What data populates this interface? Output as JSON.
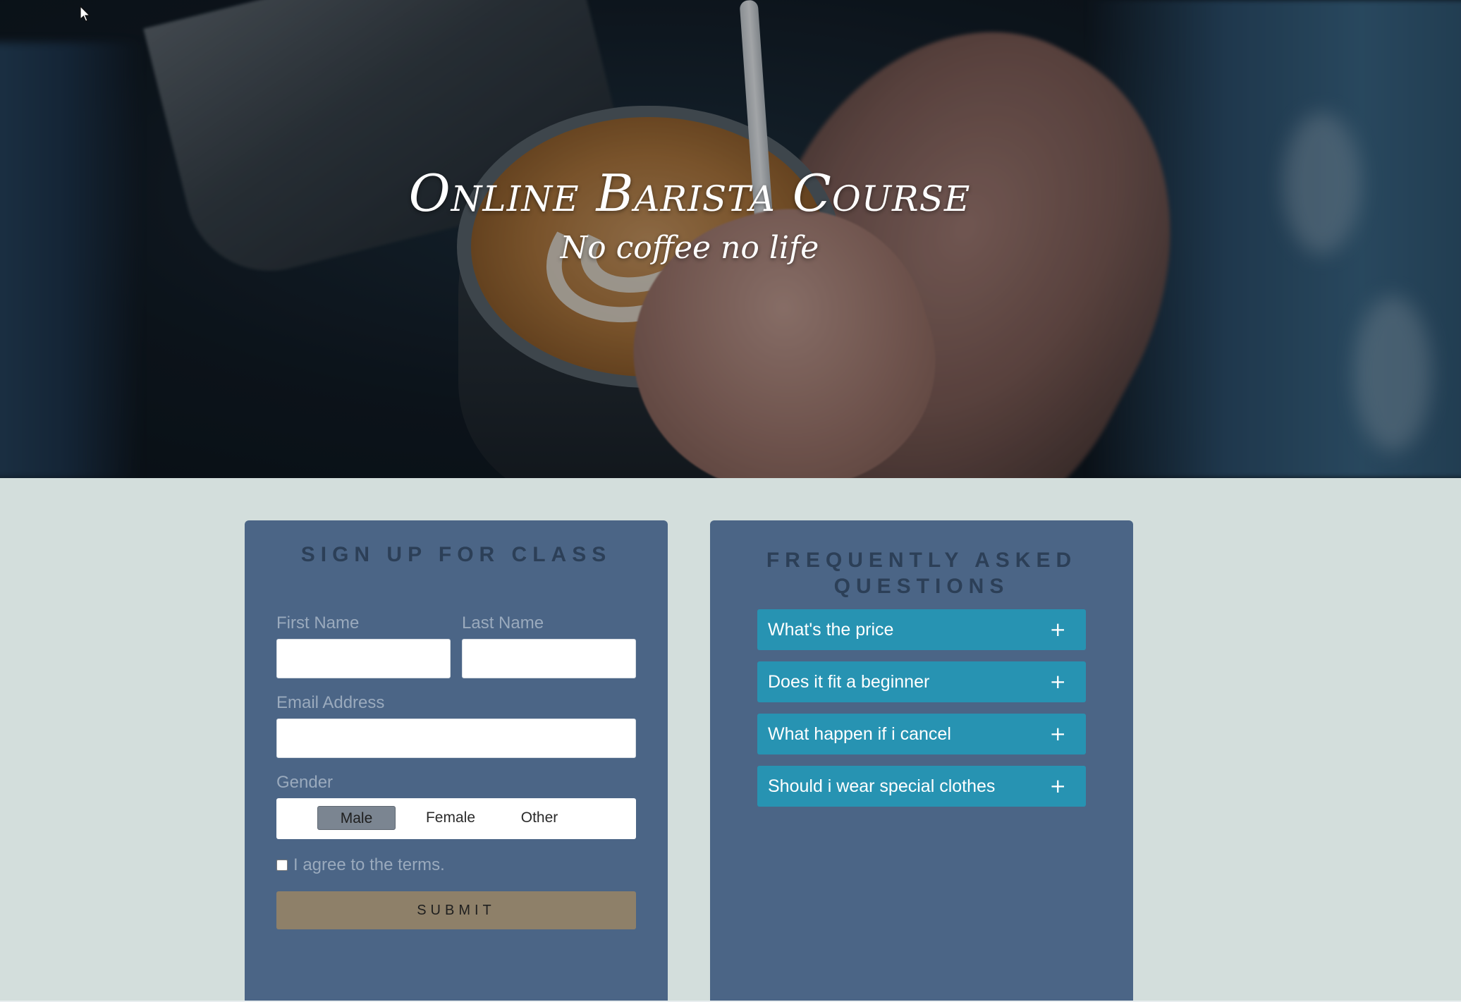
{
  "hero": {
    "title": "Online Barista Course",
    "subtitle": "No coffee no life"
  },
  "signup": {
    "heading": "SIGN UP FOR CLASS",
    "first_name_label": "First Name",
    "first_name_value": "",
    "last_name_label": "Last Name",
    "last_name_value": "",
    "email_label": "Email Address",
    "email_value": "",
    "gender_label": "Gender",
    "gender_options": [
      "Male",
      "Female",
      "Other"
    ],
    "gender_selected": "Male",
    "agree_label": "I agree to the terms.",
    "agree_checked": false,
    "submit_label": "SUBMIT"
  },
  "faq": {
    "heading": "FREQUENTLY ASKED QUESTIONS",
    "items": [
      {
        "question": "What's the price",
        "toggle": "+"
      },
      {
        "question": "Does it fit a beginner",
        "toggle": "+"
      },
      {
        "question": "What happen if i cancel",
        "toggle": "+"
      },
      {
        "question": "Should i wear special clothes",
        "toggle": "+"
      }
    ]
  },
  "colors": {
    "page_bg": "#d3dedc",
    "panel_bg": "#4b6586",
    "heading_text": "#2c3f57",
    "faq_item_bg": "#2793b2",
    "submit_bg": "#8e8069",
    "label_text": "#9aaabd"
  },
  "icons": {
    "cursor": "mouse-pointer-icon",
    "faq_toggle": "plus-icon"
  }
}
